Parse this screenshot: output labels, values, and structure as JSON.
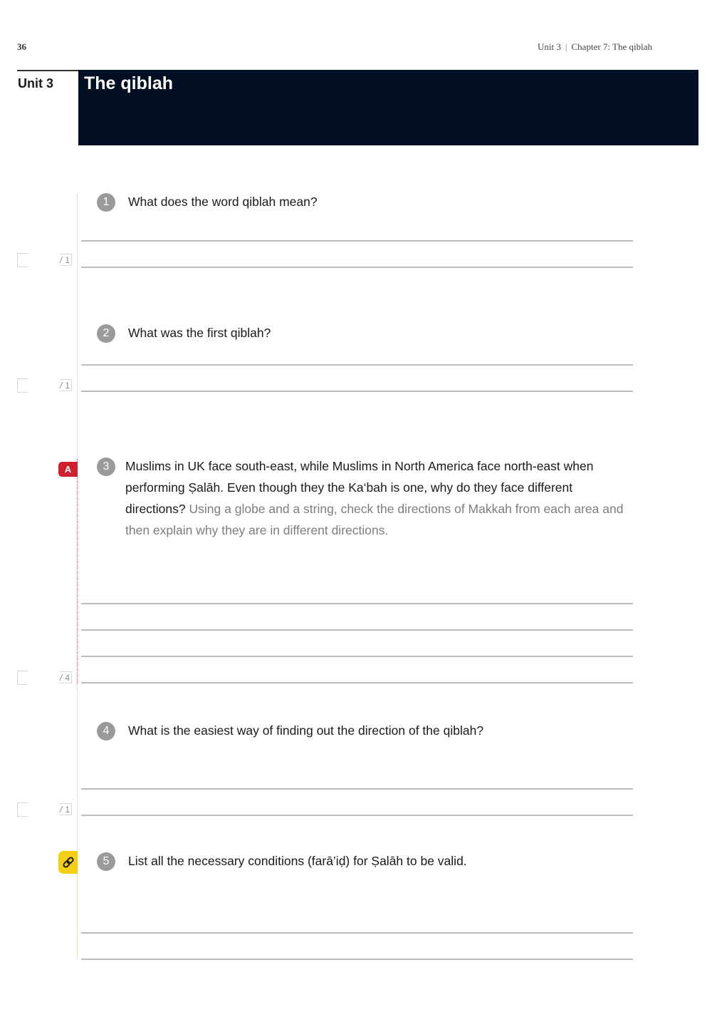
{
  "header": {
    "page_number": "36",
    "unit_ref": "Unit 3",
    "separator": "|",
    "chapter_ref": "Chapter 7:  The qiblah"
  },
  "section": {
    "unit_label": "Unit 3",
    "title": "The qiblah"
  },
  "questions": [
    {
      "number": "1",
      "text": "What does the word qiblah mean?",
      "hint": "",
      "marks": "1",
      "answer_lines": 2
    },
    {
      "number": "2",
      "text": "What was the first qiblah?",
      "hint": "",
      "marks": "1",
      "answer_lines": 2
    },
    {
      "number": "3",
      "text": "Muslims in UK face south-east, while Muslims in North America face north-east when performing Ṣalāh. Even though they the  Ka‘bah is one, why do they face dif­ferent directions?",
      "hint": "Using a globe and a string, check the directions of Makkah from each area and then explain why they are in different directions.",
      "marks": "4",
      "answer_lines": 4,
      "tab_label": "A",
      "tab_color": "#d1202d"
    },
    {
      "number": "4",
      "text": "What is the easiest way of finding out the direction of the qiblah?",
      "hint": "",
      "marks": "1",
      "answer_lines": 2
    },
    {
      "number": "5",
      "text": "List all the necessary conditions (farā’iḍ) for Ṣalāh to be valid.",
      "hint": "",
      "answer_lines": 2,
      "tab_icon": "link-icon",
      "tab_color": "#f5cf12"
    }
  ],
  "score": {
    "slash": "/"
  },
  "colors": {
    "title_band": "#020f22",
    "number_badge": "#9a9a9c",
    "hint_text": "#7d7d7d"
  }
}
